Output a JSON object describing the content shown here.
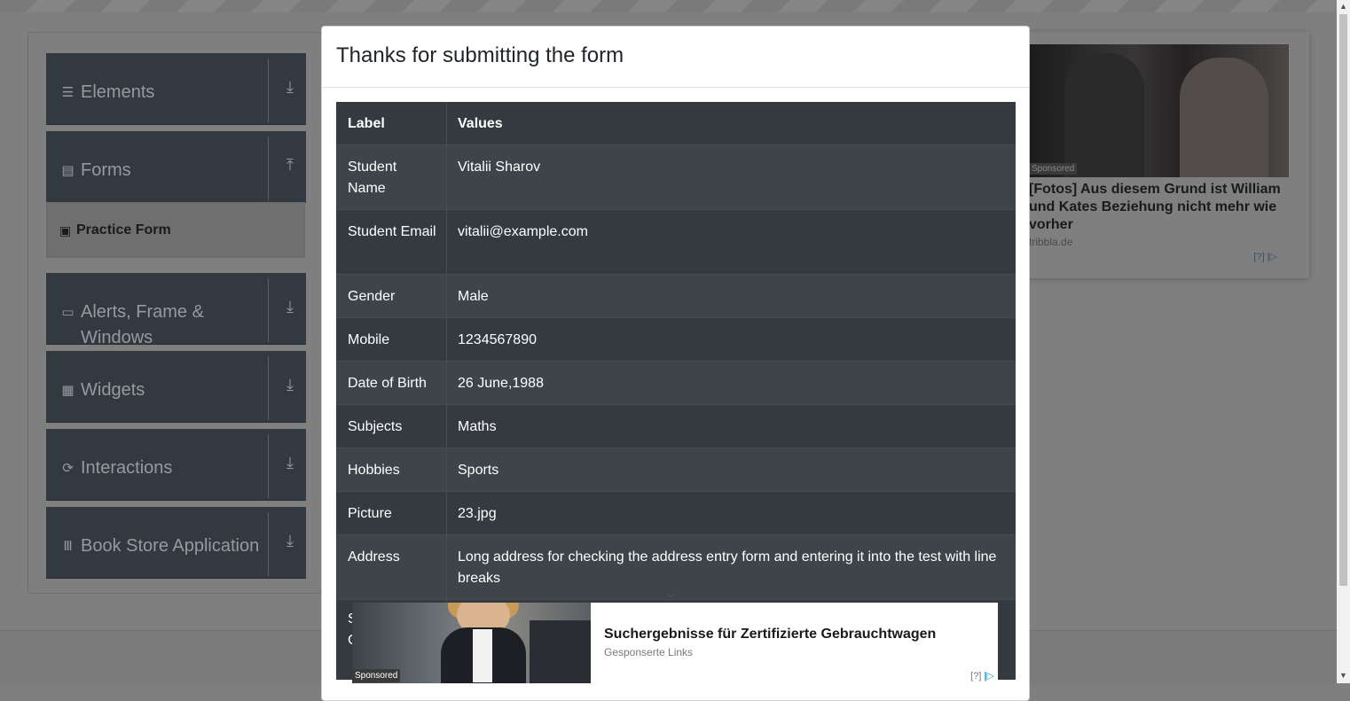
{
  "sidebar": {
    "groups": [
      {
        "label": "Elements",
        "icon": "menu-icon",
        "arrow": "download-arrow-icon"
      },
      {
        "label": "Forms",
        "icon": "document-icon",
        "arrow": "upload-arrow-icon"
      },
      {
        "label": "Alerts, Frame & Windows",
        "icon": "window-icon",
        "arrow": "download-arrow-icon"
      },
      {
        "label": "Widgets",
        "icon": "widgets-icon",
        "arrow": "download-arrow-icon"
      },
      {
        "label": "Interactions",
        "icon": "refresh-icon",
        "arrow": "download-arrow-icon"
      },
      {
        "label": "Book Store Application",
        "icon": "books-icon",
        "arrow": "download-arrow-icon"
      }
    ],
    "active_item": {
      "label": "Practice Form",
      "icon": "html5-icon"
    }
  },
  "modal": {
    "title": "Thanks for submitting the form",
    "table": {
      "headers": {
        "label": "Label",
        "values": "Values"
      },
      "rows": [
        {
          "label": "Student Name",
          "value": "Vitalii Sharov"
        },
        {
          "label": "Student Email",
          "value": "vitalii@example.com"
        },
        {
          "label": "Gender",
          "value": "Male"
        },
        {
          "label": "Mobile",
          "value": "1234567890"
        },
        {
          "label": "Date of Birth",
          "value": "26 June,1988"
        },
        {
          "label": "Subjects",
          "value": "Maths"
        },
        {
          "label": "Hobbies",
          "value": "Sports"
        },
        {
          "label": "Picture",
          "value": "23.jpg"
        },
        {
          "label": "Address",
          "value": "Long address for checking the address entry form and entering it into the test with line breaks"
        },
        {
          "label": "S C",
          "value": ""
        }
      ]
    }
  },
  "right_ad": {
    "badge": "Sponsored",
    "headline": "[Fotos] Aus diesem Grund ist William und Kates Beziehung nicht mehr wie vorher",
    "source": "tribbla.de",
    "marker": "[?]"
  },
  "bottom_ad": {
    "badge": "Sponsored",
    "headline": "Suchergebnisse für Zertifizierte Gebrauchtwagen",
    "subline": "Gesponserte Links",
    "marker": "[?]"
  },
  "colors": {
    "table_dark": "#343a40",
    "table_alt": "#3e444a",
    "overlay": "#7f7f7f",
    "ad_accent": "#1fa3d6"
  }
}
